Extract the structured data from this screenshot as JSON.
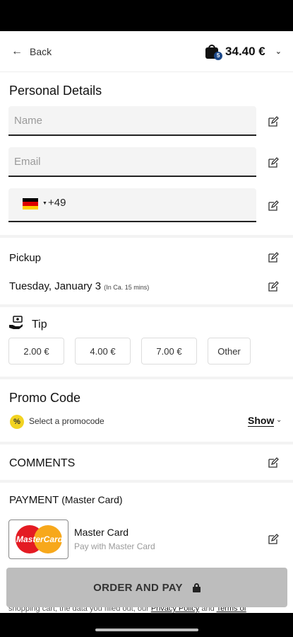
{
  "header": {
    "back_label": "Back",
    "cart_total": "34.40 €",
    "cart_count": "5"
  },
  "personal": {
    "title": "Personal Details",
    "name_placeholder": "Name",
    "email_placeholder": "Email",
    "country_flag": "germany-flag",
    "dial_code": "+49"
  },
  "pickup": {
    "title": "Pickup",
    "date": "Tuesday, January 3",
    "eta": "(In Ca. 15 mins)"
  },
  "tip": {
    "title": "Tip",
    "options": [
      "2.00 €",
      "4.00 €",
      "7.00 €",
      "Other"
    ]
  },
  "promo": {
    "title": "Promo Code",
    "badge": "%",
    "select_text": "Select a promocode",
    "show_label": "Show"
  },
  "comments": {
    "title": "COMMENTS"
  },
  "payment": {
    "title": "PAYMENT",
    "method_suffix": "(Master Card)",
    "logo_text": "MasterCard",
    "card_name": "Master Card",
    "card_sub": "Pay with Master Card"
  },
  "order": {
    "button_label": "ORDER AND PAY"
  },
  "legal": {
    "prefix": "shopping cart, the data you filled out, our ",
    "privacy": "Privacy Policy",
    "and": " and ",
    "terms": "Terms of"
  },
  "colors": {
    "button_bg": "#bdbdbd",
    "promo_badge": "#f2d321",
    "cart_badge": "#1e4a8a"
  }
}
